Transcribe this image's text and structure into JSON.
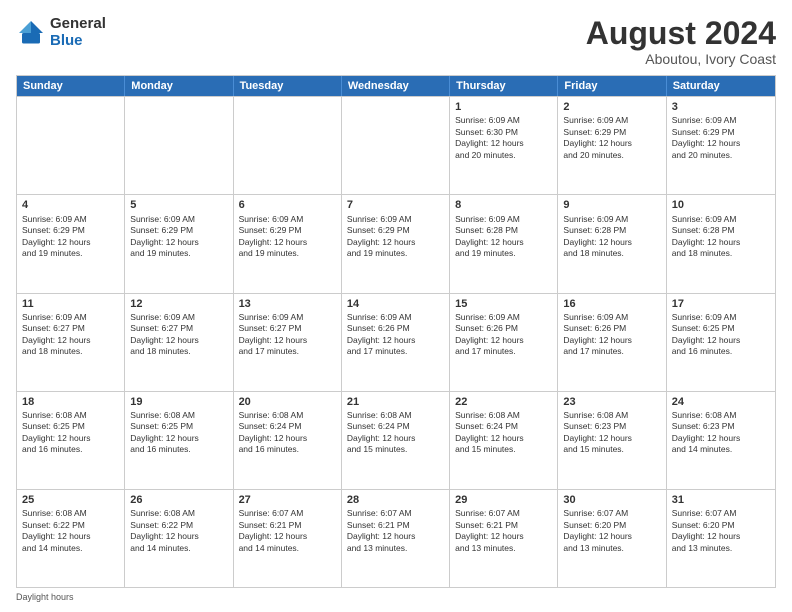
{
  "logo": {
    "general": "General",
    "blue": "Blue"
  },
  "title": {
    "main": "August 2024",
    "sub": "Aboutou, Ivory Coast"
  },
  "header_days": [
    "Sunday",
    "Monday",
    "Tuesday",
    "Wednesday",
    "Thursday",
    "Friday",
    "Saturday"
  ],
  "footer": "Daylight hours",
  "weeks": [
    [
      {
        "day": "",
        "info": ""
      },
      {
        "day": "",
        "info": ""
      },
      {
        "day": "",
        "info": ""
      },
      {
        "day": "",
        "info": ""
      },
      {
        "day": "1",
        "info": "Sunrise: 6:09 AM\nSunset: 6:30 PM\nDaylight: 12 hours\nand 20 minutes."
      },
      {
        "day": "2",
        "info": "Sunrise: 6:09 AM\nSunset: 6:29 PM\nDaylight: 12 hours\nand 20 minutes."
      },
      {
        "day": "3",
        "info": "Sunrise: 6:09 AM\nSunset: 6:29 PM\nDaylight: 12 hours\nand 20 minutes."
      }
    ],
    [
      {
        "day": "4",
        "info": "Sunrise: 6:09 AM\nSunset: 6:29 PM\nDaylight: 12 hours\nand 19 minutes."
      },
      {
        "day": "5",
        "info": "Sunrise: 6:09 AM\nSunset: 6:29 PM\nDaylight: 12 hours\nand 19 minutes."
      },
      {
        "day": "6",
        "info": "Sunrise: 6:09 AM\nSunset: 6:29 PM\nDaylight: 12 hours\nand 19 minutes."
      },
      {
        "day": "7",
        "info": "Sunrise: 6:09 AM\nSunset: 6:29 PM\nDaylight: 12 hours\nand 19 minutes."
      },
      {
        "day": "8",
        "info": "Sunrise: 6:09 AM\nSunset: 6:28 PM\nDaylight: 12 hours\nand 19 minutes."
      },
      {
        "day": "9",
        "info": "Sunrise: 6:09 AM\nSunset: 6:28 PM\nDaylight: 12 hours\nand 18 minutes."
      },
      {
        "day": "10",
        "info": "Sunrise: 6:09 AM\nSunset: 6:28 PM\nDaylight: 12 hours\nand 18 minutes."
      }
    ],
    [
      {
        "day": "11",
        "info": "Sunrise: 6:09 AM\nSunset: 6:27 PM\nDaylight: 12 hours\nand 18 minutes."
      },
      {
        "day": "12",
        "info": "Sunrise: 6:09 AM\nSunset: 6:27 PM\nDaylight: 12 hours\nand 18 minutes."
      },
      {
        "day": "13",
        "info": "Sunrise: 6:09 AM\nSunset: 6:27 PM\nDaylight: 12 hours\nand 17 minutes."
      },
      {
        "day": "14",
        "info": "Sunrise: 6:09 AM\nSunset: 6:26 PM\nDaylight: 12 hours\nand 17 minutes."
      },
      {
        "day": "15",
        "info": "Sunrise: 6:09 AM\nSunset: 6:26 PM\nDaylight: 12 hours\nand 17 minutes."
      },
      {
        "day": "16",
        "info": "Sunrise: 6:09 AM\nSunset: 6:26 PM\nDaylight: 12 hours\nand 17 minutes."
      },
      {
        "day": "17",
        "info": "Sunrise: 6:09 AM\nSunset: 6:25 PM\nDaylight: 12 hours\nand 16 minutes."
      }
    ],
    [
      {
        "day": "18",
        "info": "Sunrise: 6:08 AM\nSunset: 6:25 PM\nDaylight: 12 hours\nand 16 minutes."
      },
      {
        "day": "19",
        "info": "Sunrise: 6:08 AM\nSunset: 6:25 PM\nDaylight: 12 hours\nand 16 minutes."
      },
      {
        "day": "20",
        "info": "Sunrise: 6:08 AM\nSunset: 6:24 PM\nDaylight: 12 hours\nand 16 minutes."
      },
      {
        "day": "21",
        "info": "Sunrise: 6:08 AM\nSunset: 6:24 PM\nDaylight: 12 hours\nand 15 minutes."
      },
      {
        "day": "22",
        "info": "Sunrise: 6:08 AM\nSunset: 6:24 PM\nDaylight: 12 hours\nand 15 minutes."
      },
      {
        "day": "23",
        "info": "Sunrise: 6:08 AM\nSunset: 6:23 PM\nDaylight: 12 hours\nand 15 minutes."
      },
      {
        "day": "24",
        "info": "Sunrise: 6:08 AM\nSunset: 6:23 PM\nDaylight: 12 hours\nand 14 minutes."
      }
    ],
    [
      {
        "day": "25",
        "info": "Sunrise: 6:08 AM\nSunset: 6:22 PM\nDaylight: 12 hours\nand 14 minutes."
      },
      {
        "day": "26",
        "info": "Sunrise: 6:08 AM\nSunset: 6:22 PM\nDaylight: 12 hours\nand 14 minutes."
      },
      {
        "day": "27",
        "info": "Sunrise: 6:07 AM\nSunset: 6:21 PM\nDaylight: 12 hours\nand 14 minutes."
      },
      {
        "day": "28",
        "info": "Sunrise: 6:07 AM\nSunset: 6:21 PM\nDaylight: 12 hours\nand 13 minutes."
      },
      {
        "day": "29",
        "info": "Sunrise: 6:07 AM\nSunset: 6:21 PM\nDaylight: 12 hours\nand 13 minutes."
      },
      {
        "day": "30",
        "info": "Sunrise: 6:07 AM\nSunset: 6:20 PM\nDaylight: 12 hours\nand 13 minutes."
      },
      {
        "day": "31",
        "info": "Sunrise: 6:07 AM\nSunset: 6:20 PM\nDaylight: 12 hours\nand 13 minutes."
      }
    ]
  ]
}
